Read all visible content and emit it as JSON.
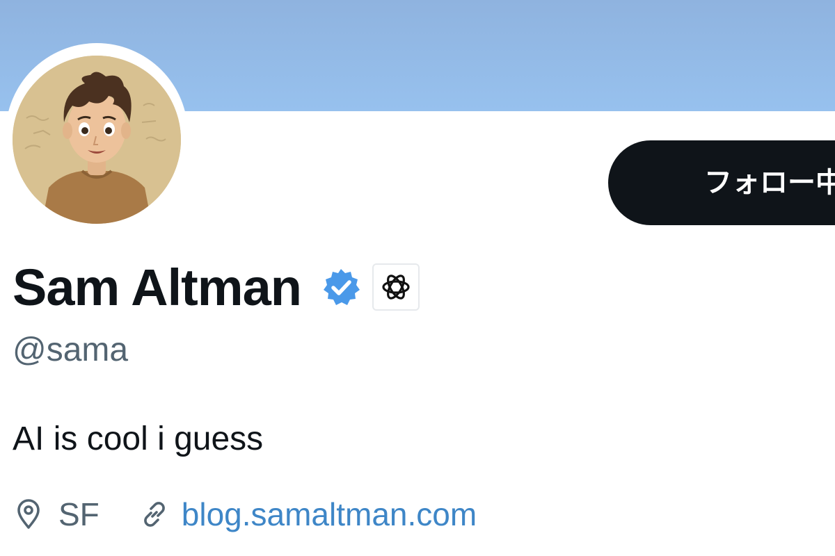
{
  "profile": {
    "display_name": "Sam Altman",
    "handle": "@sama",
    "bio": "AI is cool i guess",
    "location": "SF",
    "website": "blog.samaltman.com",
    "follow_button_label": "フォロー中"
  },
  "icons": {
    "verified": "verified-badge-icon",
    "affiliate": "openai-logo-icon",
    "location": "location-pin-icon",
    "link": "link-icon"
  },
  "colors": {
    "banner": "#97c1ee",
    "verified": "#4a99e9",
    "link": "#3e86c7",
    "button": "#0f1419"
  }
}
